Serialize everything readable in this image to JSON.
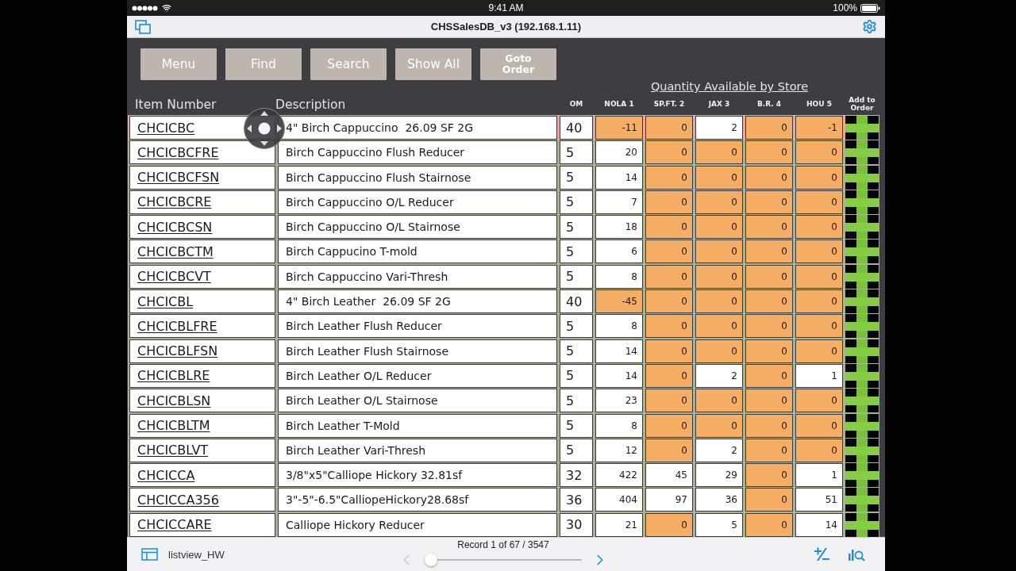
{
  "status_bar": {
    "time": "9:41 AM",
    "battery": "100%"
  },
  "title_bar": {
    "title": "CHSSalesDB_v3 (192.168.1.11)"
  },
  "toolbar": {
    "buttons": [
      {
        "label": "Menu",
        "kind": "plain"
      },
      {
        "label": "Find",
        "kind": "plain"
      },
      {
        "label": "Search",
        "kind": "plain"
      },
      {
        "label": "Show All",
        "kind": "plain"
      },
      {
        "label": "Goto Order",
        "kind": "emphasis"
      }
    ]
  },
  "table": {
    "group_heading": "Quantity Available by Store",
    "columns": [
      {
        "label": "Item Number",
        "kind": "main"
      },
      {
        "label": "Description",
        "kind": "main"
      },
      {
        "label": "OM",
        "kind": "small"
      },
      {
        "label": "NOLA 1",
        "kind": "small"
      },
      {
        "label": "SP.FT. 2",
        "kind": "small"
      },
      {
        "label": "JAX 3",
        "kind": "small"
      },
      {
        "label": "B.R. 4",
        "kind": "small"
      },
      {
        "label": "HOU 5",
        "kind": "small"
      },
      {
        "label": "Add to Order",
        "kind": "small"
      }
    ],
    "rows": [
      {
        "item": "CHCICBC",
        "description": "4\" Birch Cappuccino  26.09 SF 2G",
        "om": "40",
        "selected": true,
        "stores": [
          {
            "value": "-11",
            "highlighted": true
          },
          {
            "value": "0",
            "highlighted": true
          },
          {
            "value": "2",
            "highlighted": false
          },
          {
            "value": "0",
            "highlighted": true
          },
          {
            "value": "-1",
            "highlighted": true
          }
        ]
      },
      {
        "item": "CHCICBCFRE",
        "description": "Birch Cappuccino Flush Reducer",
        "om": "5",
        "selected": false,
        "stores": [
          {
            "value": "20",
            "highlighted": false
          },
          {
            "value": "0",
            "highlighted": true
          },
          {
            "value": "0",
            "highlighted": true
          },
          {
            "value": "0",
            "highlighted": true
          },
          {
            "value": "0",
            "highlighted": true
          }
        ]
      },
      {
        "item": "CHCICBCFSN",
        "description": "Birch Cappuccino Flush Stairnose",
        "om": "5",
        "selected": false,
        "stores": [
          {
            "value": "14",
            "highlighted": false
          },
          {
            "value": "0",
            "highlighted": true
          },
          {
            "value": "0",
            "highlighted": true
          },
          {
            "value": "0",
            "highlighted": true
          },
          {
            "value": "0",
            "highlighted": true
          }
        ]
      },
      {
        "item": "CHCICBCRE",
        "description": "Birch Cappuccino O/L Reducer",
        "om": "5",
        "selected": false,
        "stores": [
          {
            "value": "7",
            "highlighted": false
          },
          {
            "value": "0",
            "highlighted": true
          },
          {
            "value": "0",
            "highlighted": true
          },
          {
            "value": "0",
            "highlighted": true
          },
          {
            "value": "0",
            "highlighted": true
          }
        ]
      },
      {
        "item": "CHCICBCSN",
        "description": "Birch Cappuccino O/L Stairnose",
        "om": "5",
        "selected": false,
        "stores": [
          {
            "value": "18",
            "highlighted": false
          },
          {
            "value": "0",
            "highlighted": true
          },
          {
            "value": "0",
            "highlighted": true
          },
          {
            "value": "0",
            "highlighted": true
          },
          {
            "value": "0",
            "highlighted": true
          }
        ]
      },
      {
        "item": "CHCICBCTM",
        "description": "Birch Cappucino T-mold",
        "om": "5",
        "selected": false,
        "stores": [
          {
            "value": "6",
            "highlighted": false
          },
          {
            "value": "0",
            "highlighted": true
          },
          {
            "value": "0",
            "highlighted": true
          },
          {
            "value": "0",
            "highlighted": true
          },
          {
            "value": "0",
            "highlighted": true
          }
        ]
      },
      {
        "item": "CHCICBCVT",
        "description": "Birch Cappuccino Vari-Thresh",
        "om": "5",
        "selected": false,
        "stores": [
          {
            "value": "8",
            "highlighted": false
          },
          {
            "value": "0",
            "highlighted": true
          },
          {
            "value": "0",
            "highlighted": true
          },
          {
            "value": "0",
            "highlighted": true
          },
          {
            "value": "0",
            "highlighted": true
          }
        ]
      },
      {
        "item": "CHCICBL",
        "description": "4\" Birch Leather  26.09 SF 2G",
        "om": "40",
        "selected": false,
        "stores": [
          {
            "value": "-45",
            "highlighted": true
          },
          {
            "value": "0",
            "highlighted": true
          },
          {
            "value": "0",
            "highlighted": true
          },
          {
            "value": "0",
            "highlighted": true
          },
          {
            "value": "0",
            "highlighted": true
          }
        ]
      },
      {
        "item": "CHCICBLFRE",
        "description": "Birch Leather Flush Reducer",
        "om": "5",
        "selected": false,
        "stores": [
          {
            "value": "8",
            "highlighted": false
          },
          {
            "value": "0",
            "highlighted": true
          },
          {
            "value": "0",
            "highlighted": true
          },
          {
            "value": "0",
            "highlighted": true
          },
          {
            "value": "0",
            "highlighted": true
          }
        ]
      },
      {
        "item": "CHCICBLFSN",
        "description": "Birch Leather Flush Stairnose",
        "om": "5",
        "selected": false,
        "stores": [
          {
            "value": "14",
            "highlighted": false
          },
          {
            "value": "0",
            "highlighted": true
          },
          {
            "value": "0",
            "highlighted": true
          },
          {
            "value": "0",
            "highlighted": true
          },
          {
            "value": "0",
            "highlighted": true
          }
        ]
      },
      {
        "item": "CHCICBLRE",
        "description": "Birch Leather O/L Reducer",
        "om": "5",
        "selected": false,
        "stores": [
          {
            "value": "14",
            "highlighted": false
          },
          {
            "value": "0",
            "highlighted": true
          },
          {
            "value": "2",
            "highlighted": false
          },
          {
            "value": "0",
            "highlighted": true
          },
          {
            "value": "1",
            "highlighted": false
          }
        ]
      },
      {
        "item": "CHCICBLSN",
        "description": "Birch Leather O/L Stairnose",
        "om": "5",
        "selected": false,
        "stores": [
          {
            "value": "23",
            "highlighted": false
          },
          {
            "value": "0",
            "highlighted": true
          },
          {
            "value": "0",
            "highlighted": true
          },
          {
            "value": "0",
            "highlighted": true
          },
          {
            "value": "0",
            "highlighted": true
          }
        ]
      },
      {
        "item": "CHCICBLTM",
        "description": "Birch Leather T-Mold",
        "om": "5",
        "selected": false,
        "stores": [
          {
            "value": "8",
            "highlighted": false
          },
          {
            "value": "0",
            "highlighted": true
          },
          {
            "value": "0",
            "highlighted": true
          },
          {
            "value": "0",
            "highlighted": true
          },
          {
            "value": "0",
            "highlighted": true
          }
        ]
      },
      {
        "item": "CHCICBLVT",
        "description": "Birch Leather Vari-Thresh",
        "om": "5",
        "selected": false,
        "stores": [
          {
            "value": "12",
            "highlighted": false
          },
          {
            "value": "0",
            "highlighted": true
          },
          {
            "value": "2",
            "highlighted": false
          },
          {
            "value": "0",
            "highlighted": true
          },
          {
            "value": "0",
            "highlighted": true
          }
        ]
      },
      {
        "item": "CHCICCA",
        "description": "3/8\"x5\"Calliope Hickory 32.81sf",
        "om": "32",
        "selected": false,
        "stores": [
          {
            "value": "422",
            "highlighted": false
          },
          {
            "value": "45",
            "highlighted": false
          },
          {
            "value": "29",
            "highlighted": false
          },
          {
            "value": "0",
            "highlighted": true
          },
          {
            "value": "1",
            "highlighted": false
          }
        ]
      },
      {
        "item": "CHCICCA356",
        "description": "3\"-5\"-6.5\"CalliopeHickory28.68sf",
        "om": "36",
        "selected": false,
        "stores": [
          {
            "value": "404",
            "highlighted": false
          },
          {
            "value": "97",
            "highlighted": false
          },
          {
            "value": "36",
            "highlighted": false
          },
          {
            "value": "0",
            "highlighted": true
          },
          {
            "value": "51",
            "highlighted": false
          }
        ]
      },
      {
        "item": "CHCICCARE",
        "description": "Calliope Hickory Reducer",
        "om": "30",
        "selected": false,
        "stores": [
          {
            "value": "21",
            "highlighted": false
          },
          {
            "value": "0",
            "highlighted": true
          },
          {
            "value": "5",
            "highlighted": false
          },
          {
            "value": "0",
            "highlighted": true
          },
          {
            "value": "14",
            "highlighted": false
          }
        ]
      }
    ]
  },
  "footer": {
    "layout": "listview_HW",
    "record": "Record 1 of 67 / 3547",
    "slider": {
      "level": 0
    },
    "previous": {
      "disabled": true
    },
    "next": {
      "disabled": false
    }
  }
}
